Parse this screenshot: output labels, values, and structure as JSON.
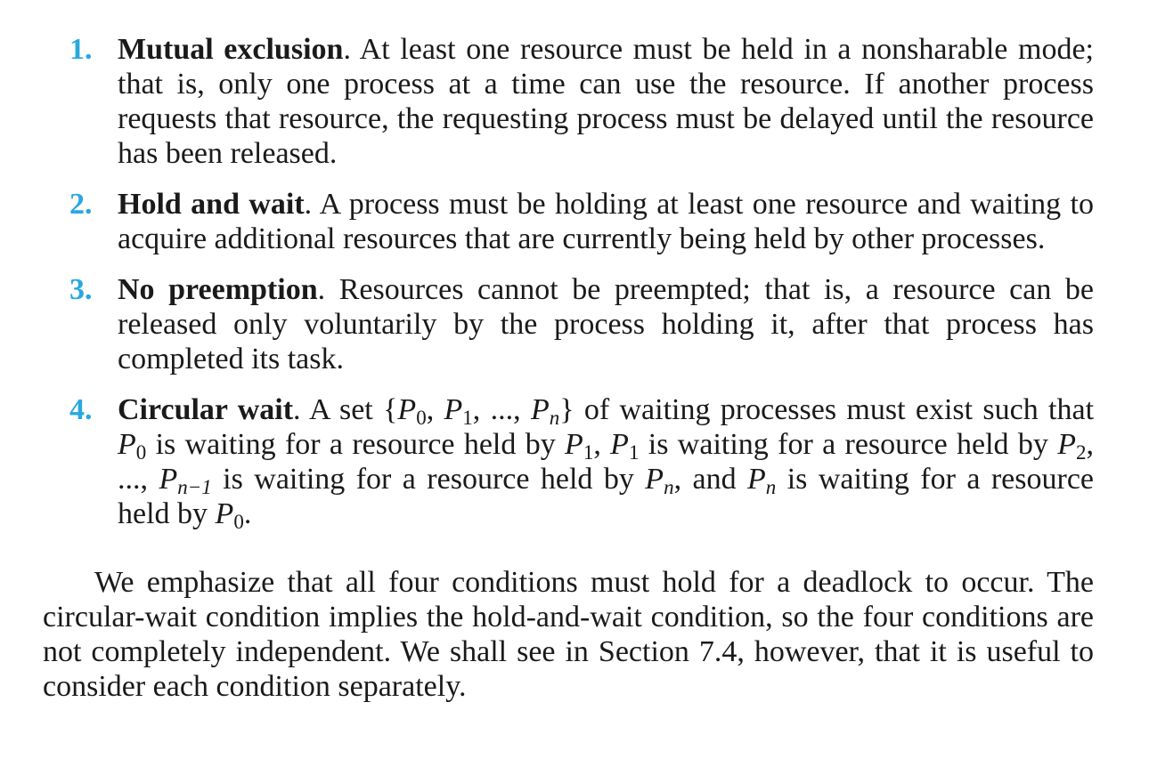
{
  "conditions": [
    {
      "number": "1.",
      "term": "Mutual exclusion",
      "text": ". At least one resource must be held in a nonsharable mode; that is, only one process at a time can use the resource. If another process requests that resource, the requesting process must be delayed until the resource has been released."
    },
    {
      "number": "2.",
      "term": "Hold and wait",
      "text": ". A process must be holding at least one resource and waiting to acquire additional resources that are currently being held by other processes."
    },
    {
      "number": "3.",
      "term": "No preemption",
      "text": ". Resources cannot be preempted; that is, a resource can be released only voluntarily by the process holding it, after that process has completed its task."
    },
    {
      "number": "4.",
      "term": "Circular wait",
      "parts": {
        "t0": ". A set {",
        "p": "P",
        "s0": "0",
        "c1": ", ",
        "s1": "1",
        "c2": ", ..., ",
        "sn": "n",
        "t1": "} of waiting processes must exist such that ",
        "t2": " is waiting for a resource held by ",
        "t3": ", ",
        "t4": " is waiting for a resource held by ",
        "s2": "2",
        "t5": ", ..., ",
        "snm1": "n−1",
        "t6": " is waiting for a resource held by ",
        "t7": ", and ",
        "t8": " is waiting for a resource held by ",
        "t9": "."
      }
    }
  ],
  "summary": "We emphasize that all four conditions must hold for a deadlock to occur. The circular-wait condition implies the hold-and-wait condition, so the four conditions are not completely independent. We shall see in Section 7.4, however, that it is useful to consider each condition separately."
}
